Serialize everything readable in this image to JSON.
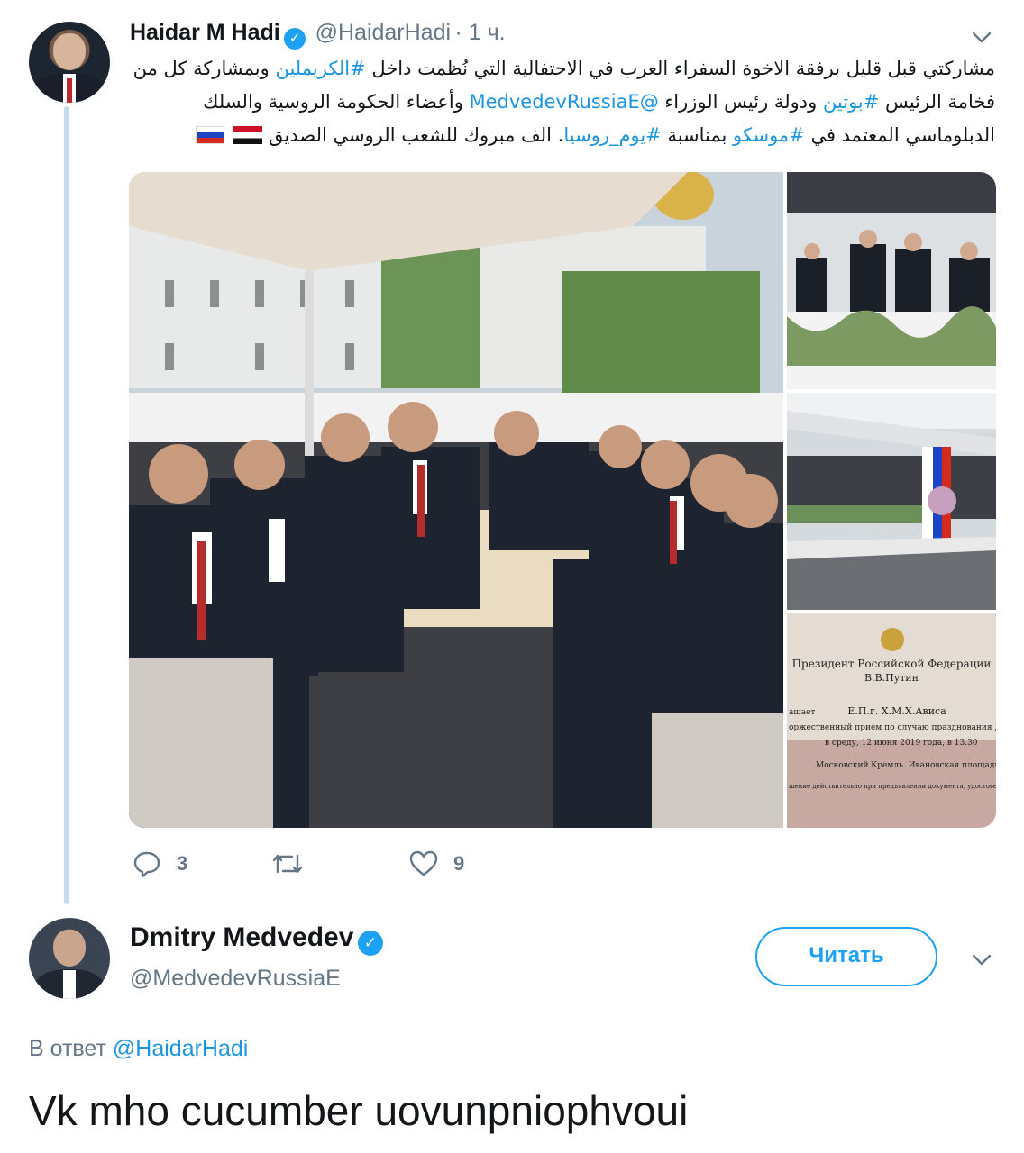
{
  "tweet": {
    "author_name": "Haidar M Hadi",
    "author_handle": "@HaidarHadi",
    "time": "· 1 ч.",
    "text_line1_a": "مشاركتي قبل قليل برفقة الاخوة السفراء العرب في الاحتفالية التي نُظمت داخل ",
    "text_line1_link": "#الكريملين",
    "text_line1_b": " وبمشاركة كل من",
    "text_line2_a": "فخامة الرئيس ",
    "text_line2_link1": "#بوتين",
    "text_line2_b": " ودولة رئيس الوزراء ",
    "text_line2_link2": "@MedvedevRussiaE",
    "text_line2_c": " وأعضاء الحكومة الروسية والسلك",
    "text_line3_a": "الدبلوماسي المعتمد في ",
    "text_line3_link1": "#موسكو",
    "text_line3_b": " بمناسبة ",
    "text_line3_link2": "#يوم_روسيا",
    "text_line3_c": ". الف مبروك للشعب الروسي الصديق",
    "invitation_text": {
      "line1": "Президент Российской Федерации",
      "line2": "В.В.Путин",
      "line3a": "ашает",
      "line3b": "Е.П.г. Х.М.Х.Ависа",
      "line4": "оржественный прием по случаю празднования Дня",
      "line5": "в среду, 12 июня 2019 года, в 13.30",
      "line6": "Московский Кремль. Ивановская площадь",
      "line7": "шение действительно при предъявлении документа, удостоверяющ"
    },
    "replies": "3",
    "likes": "9"
  },
  "reply": {
    "author_name": "Dmitry Medvedev",
    "author_handle": "@MedvedevRussiaE",
    "follow_label": "Читать",
    "in_reply_prefix": "В ответ",
    "in_reply_handle": "@HaidarHadi",
    "text": "Vk mho cucumber uovunpniophvoui"
  },
  "colors": {
    "accent": "#1da1f2",
    "link": "#1b95e0",
    "muted": "#657786",
    "thread_line": "#c6dcef"
  },
  "icons": {
    "reply": "reply-icon",
    "retweet": "retweet-icon",
    "like": "heart-icon",
    "menu": "chevron-down-icon",
    "verified": "verified-badge-icon"
  }
}
